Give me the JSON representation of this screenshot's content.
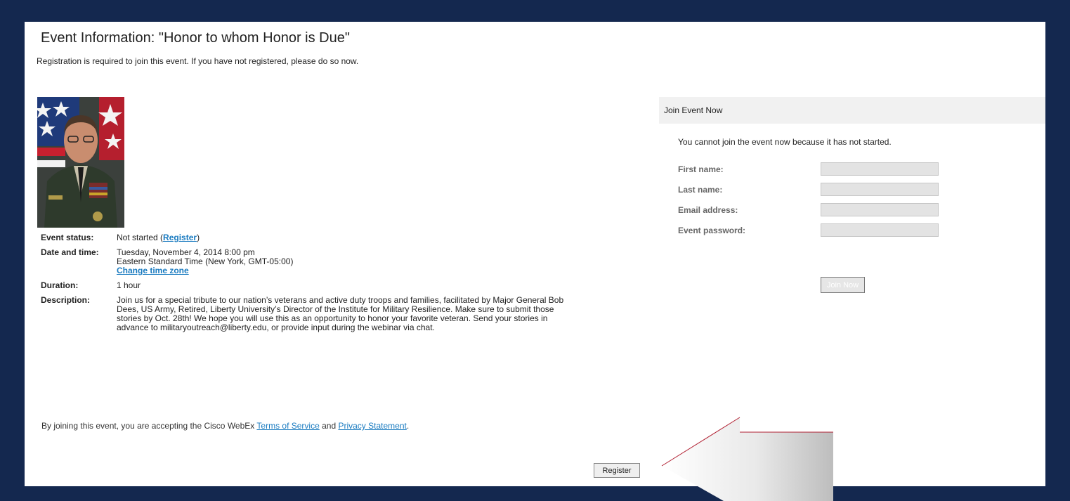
{
  "header": {
    "title": "Event Information: \"Honor to whom Honor is Due\"",
    "registration_note": "Registration is required to join this event. If you have not registered, please do so now."
  },
  "event": {
    "status_label": "Event status:",
    "status_value": "Not started (",
    "status_link": "Register",
    "status_close": ")",
    "date_label": "Date and time:",
    "date_line1": "Tuesday, November 4, 2014 8:00 pm",
    "date_line2": "Eastern Standard Time (New York, GMT-05:00)",
    "change_tz": "Change time zone",
    "duration_label": "Duration:",
    "duration_value": "1 hour",
    "description_label": "Description:",
    "description": "Join us for a special tribute to our nation’s veterans and active duty troops and families, facilitated by Major General Bob Dees, US Army, Retired, Liberty University’s Director of the Institute for Military Resilience. Make sure to submit those stories by Oct. 28th! We hope you will use this as an opportunity to honor your favorite veteran. Send your stories in advance to militaryoutreach@liberty.edu, or provide input during the webinar via chat."
  },
  "footer": {
    "tos_prefix": "By joining this event, you are accepting the Cisco WebEx ",
    "tos_link": "Terms of Service",
    "tos_and": " and ",
    "privacy_link": "Privacy Statement",
    "tos_suffix": ".",
    "register_button": "Register"
  },
  "join": {
    "heading": "Join Event Now",
    "message": "You cannot join the event now because it has not started.",
    "first_name_label": "First name:",
    "last_name_label": "Last name:",
    "email_label": "Email address:",
    "password_label": "Event password:",
    "join_button": "Join Now"
  },
  "colors": {
    "frame": "#14284f",
    "link": "#1a7bc0",
    "arrow_edge": "#b22234"
  },
  "icons": {
    "pointer": "arrow-pointer-icon"
  }
}
